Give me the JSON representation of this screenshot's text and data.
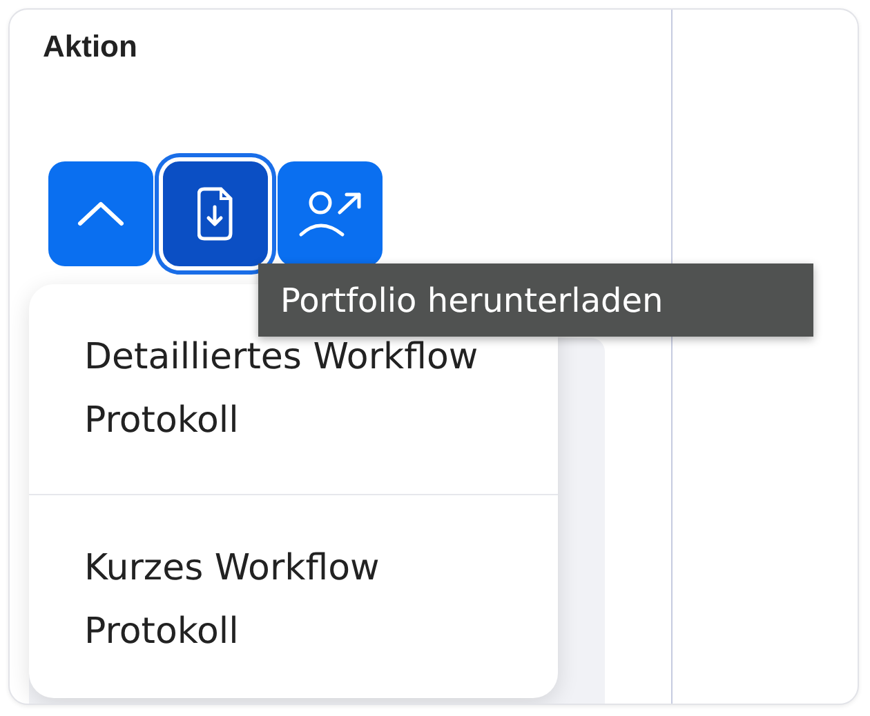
{
  "column_header": "Aktion",
  "buttons": [
    {
      "kind": "collapse",
      "selected": false
    },
    {
      "kind": "download",
      "selected": true
    },
    {
      "kind": "assign",
      "selected": false
    }
  ],
  "tooltip": "Portfolio herunterladen",
  "menu": [
    {
      "label": "Detailliertes Workflow Protokoll"
    },
    {
      "label": "Kurzes Workflow Protokoll"
    }
  ]
}
